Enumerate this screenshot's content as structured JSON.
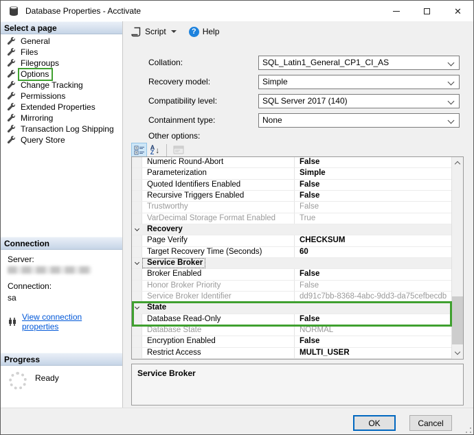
{
  "window": {
    "title": "Database Properties - Acctivate"
  },
  "toolbar": {
    "script_label": "Script",
    "help_label": "Help"
  },
  "sidebar": {
    "select_a_page_label": "Select a page",
    "pages": [
      {
        "label": "General"
      },
      {
        "label": "Files"
      },
      {
        "label": "Filegroups"
      },
      {
        "label": "Options",
        "annotated": true
      },
      {
        "label": "Change Tracking"
      },
      {
        "label": "Permissions"
      },
      {
        "label": "Extended Properties"
      },
      {
        "label": "Mirroring"
      },
      {
        "label": "Transaction Log Shipping"
      },
      {
        "label": "Query Store"
      }
    ],
    "connection": {
      "header": "Connection",
      "server_label": "Server:",
      "connection_label": "Connection:",
      "connection_value": "sa",
      "view_link": "View connection properties"
    },
    "progress": {
      "header": "Progress",
      "status": "Ready"
    }
  },
  "options_form": {
    "fields": [
      {
        "label": "Collation:",
        "value": "SQL_Latin1_General_CP1_CI_AS"
      },
      {
        "label": "Recovery model:",
        "value": "Simple"
      },
      {
        "label": "Compatibility level:",
        "value": "SQL Server 2017 (140)"
      },
      {
        "label": "Containment type:",
        "value": "None"
      }
    ],
    "other_options_label": "Other options:"
  },
  "property_grid": {
    "rows": [
      {
        "type": "property",
        "name": "Numeric Round-Abort",
        "value": "False",
        "bold": true
      },
      {
        "type": "property",
        "name": "Parameterization",
        "value": "Simple",
        "bold": true
      },
      {
        "type": "property",
        "name": "Quoted Identifiers Enabled",
        "value": "False",
        "bold": true
      },
      {
        "type": "property",
        "name": "Recursive Triggers Enabled",
        "value": "False",
        "bold": true
      },
      {
        "type": "property",
        "name": "Trustworthy",
        "value": "False",
        "disabled": true
      },
      {
        "type": "property",
        "name": "VarDecimal Storage Format Enabled",
        "value": "True",
        "disabled": true
      },
      {
        "type": "category",
        "name": "Recovery"
      },
      {
        "type": "property",
        "name": "Page Verify",
        "value": "CHECKSUM",
        "bold": true
      },
      {
        "type": "property",
        "name": "Target Recovery Time (Seconds)",
        "value": "60",
        "bold": true
      },
      {
        "type": "category",
        "name": "Service Broker",
        "focused": true
      },
      {
        "type": "property",
        "name": "Broker Enabled",
        "value": "False",
        "bold": true
      },
      {
        "type": "property",
        "name": "Honor Broker Priority",
        "value": "False",
        "disabled": true
      },
      {
        "type": "property",
        "name": "Service Broker Identifier",
        "value": "dd91c7bb-8368-4abc-9dd3-da75cefbecdb",
        "disabled": true
      },
      {
        "type": "category",
        "name": "State",
        "highlight": true
      },
      {
        "type": "property",
        "name": "Database Read-Only",
        "value": "False",
        "bold": true,
        "highlight": true
      },
      {
        "type": "property",
        "name": "Database State",
        "value": "NORMAL",
        "disabled": true
      },
      {
        "type": "property",
        "name": "Encryption Enabled",
        "value": "False",
        "bold": true
      },
      {
        "type": "property",
        "name": "Restrict Access",
        "value": "MULTI_USER",
        "bold": true
      }
    ],
    "description_title": "Service Broker"
  },
  "footer": {
    "ok_label": "OK",
    "cancel_label": "Cancel"
  },
  "colors": {
    "annotation_green": "#3fa02f",
    "focus_blue": "#0067c0",
    "link_blue": "#0057d8",
    "header_gradient_top": "#e9eff7",
    "header_gradient_bottom": "#c6d5e7",
    "panel_gray": "#f0f0f0"
  }
}
